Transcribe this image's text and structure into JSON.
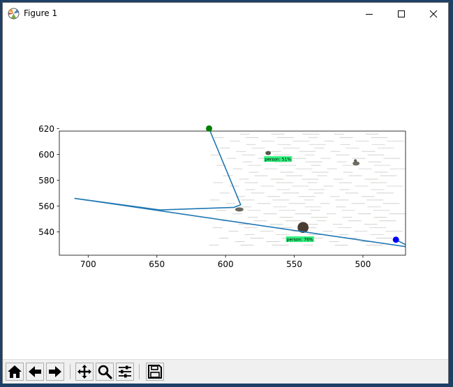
{
  "window": {
    "title": "Figure 1"
  },
  "toolbar": {
    "buttons": [
      "home-icon",
      "back-icon",
      "forward-icon",
      "pan-icon",
      "zoom-icon",
      "configure-icon",
      "save-icon"
    ]
  },
  "chart_data": {
    "type": "line",
    "title": "",
    "xlabel": "",
    "ylabel": "",
    "xlim": [
      721,
      469
    ],
    "ylim": [
      618,
      522
    ],
    "xticks": [
      700,
      650,
      600,
      550,
      500
    ],
    "yticks": [
      540,
      560,
      580,
      600,
      620
    ],
    "tick_labels_x": [
      "700",
      "650",
      "600",
      "550",
      "500"
    ],
    "tick_labels_y": [
      "540",
      "560",
      "580",
      "600",
      "620"
    ],
    "image": {
      "extent_x": [
        612,
        474
      ],
      "extent_y": [
        533,
        620
      ],
      "detections": [
        {
          "label": "person: 76%",
          "x0": 556,
          "x1": 536,
          "y0": 536,
          "y1": 619
        },
        {
          "label": "person: 51%",
          "x0": 572,
          "x1": 565,
          "y0": 598,
          "y1": 604
        }
      ]
    },
    "series": [
      {
        "x": [
          612,
          589,
          594,
          648,
          710,
          465,
          476
        ],
        "y": [
          620,
          561,
          559,
          557,
          566,
          528,
          534
        ],
        "color": "#1f77b4"
      }
    ],
    "markers": [
      {
        "x": 476,
        "y": 534,
        "color": "#0000ff"
      },
      {
        "x": 612,
        "y": 620,
        "color": "#008000"
      }
    ]
  }
}
